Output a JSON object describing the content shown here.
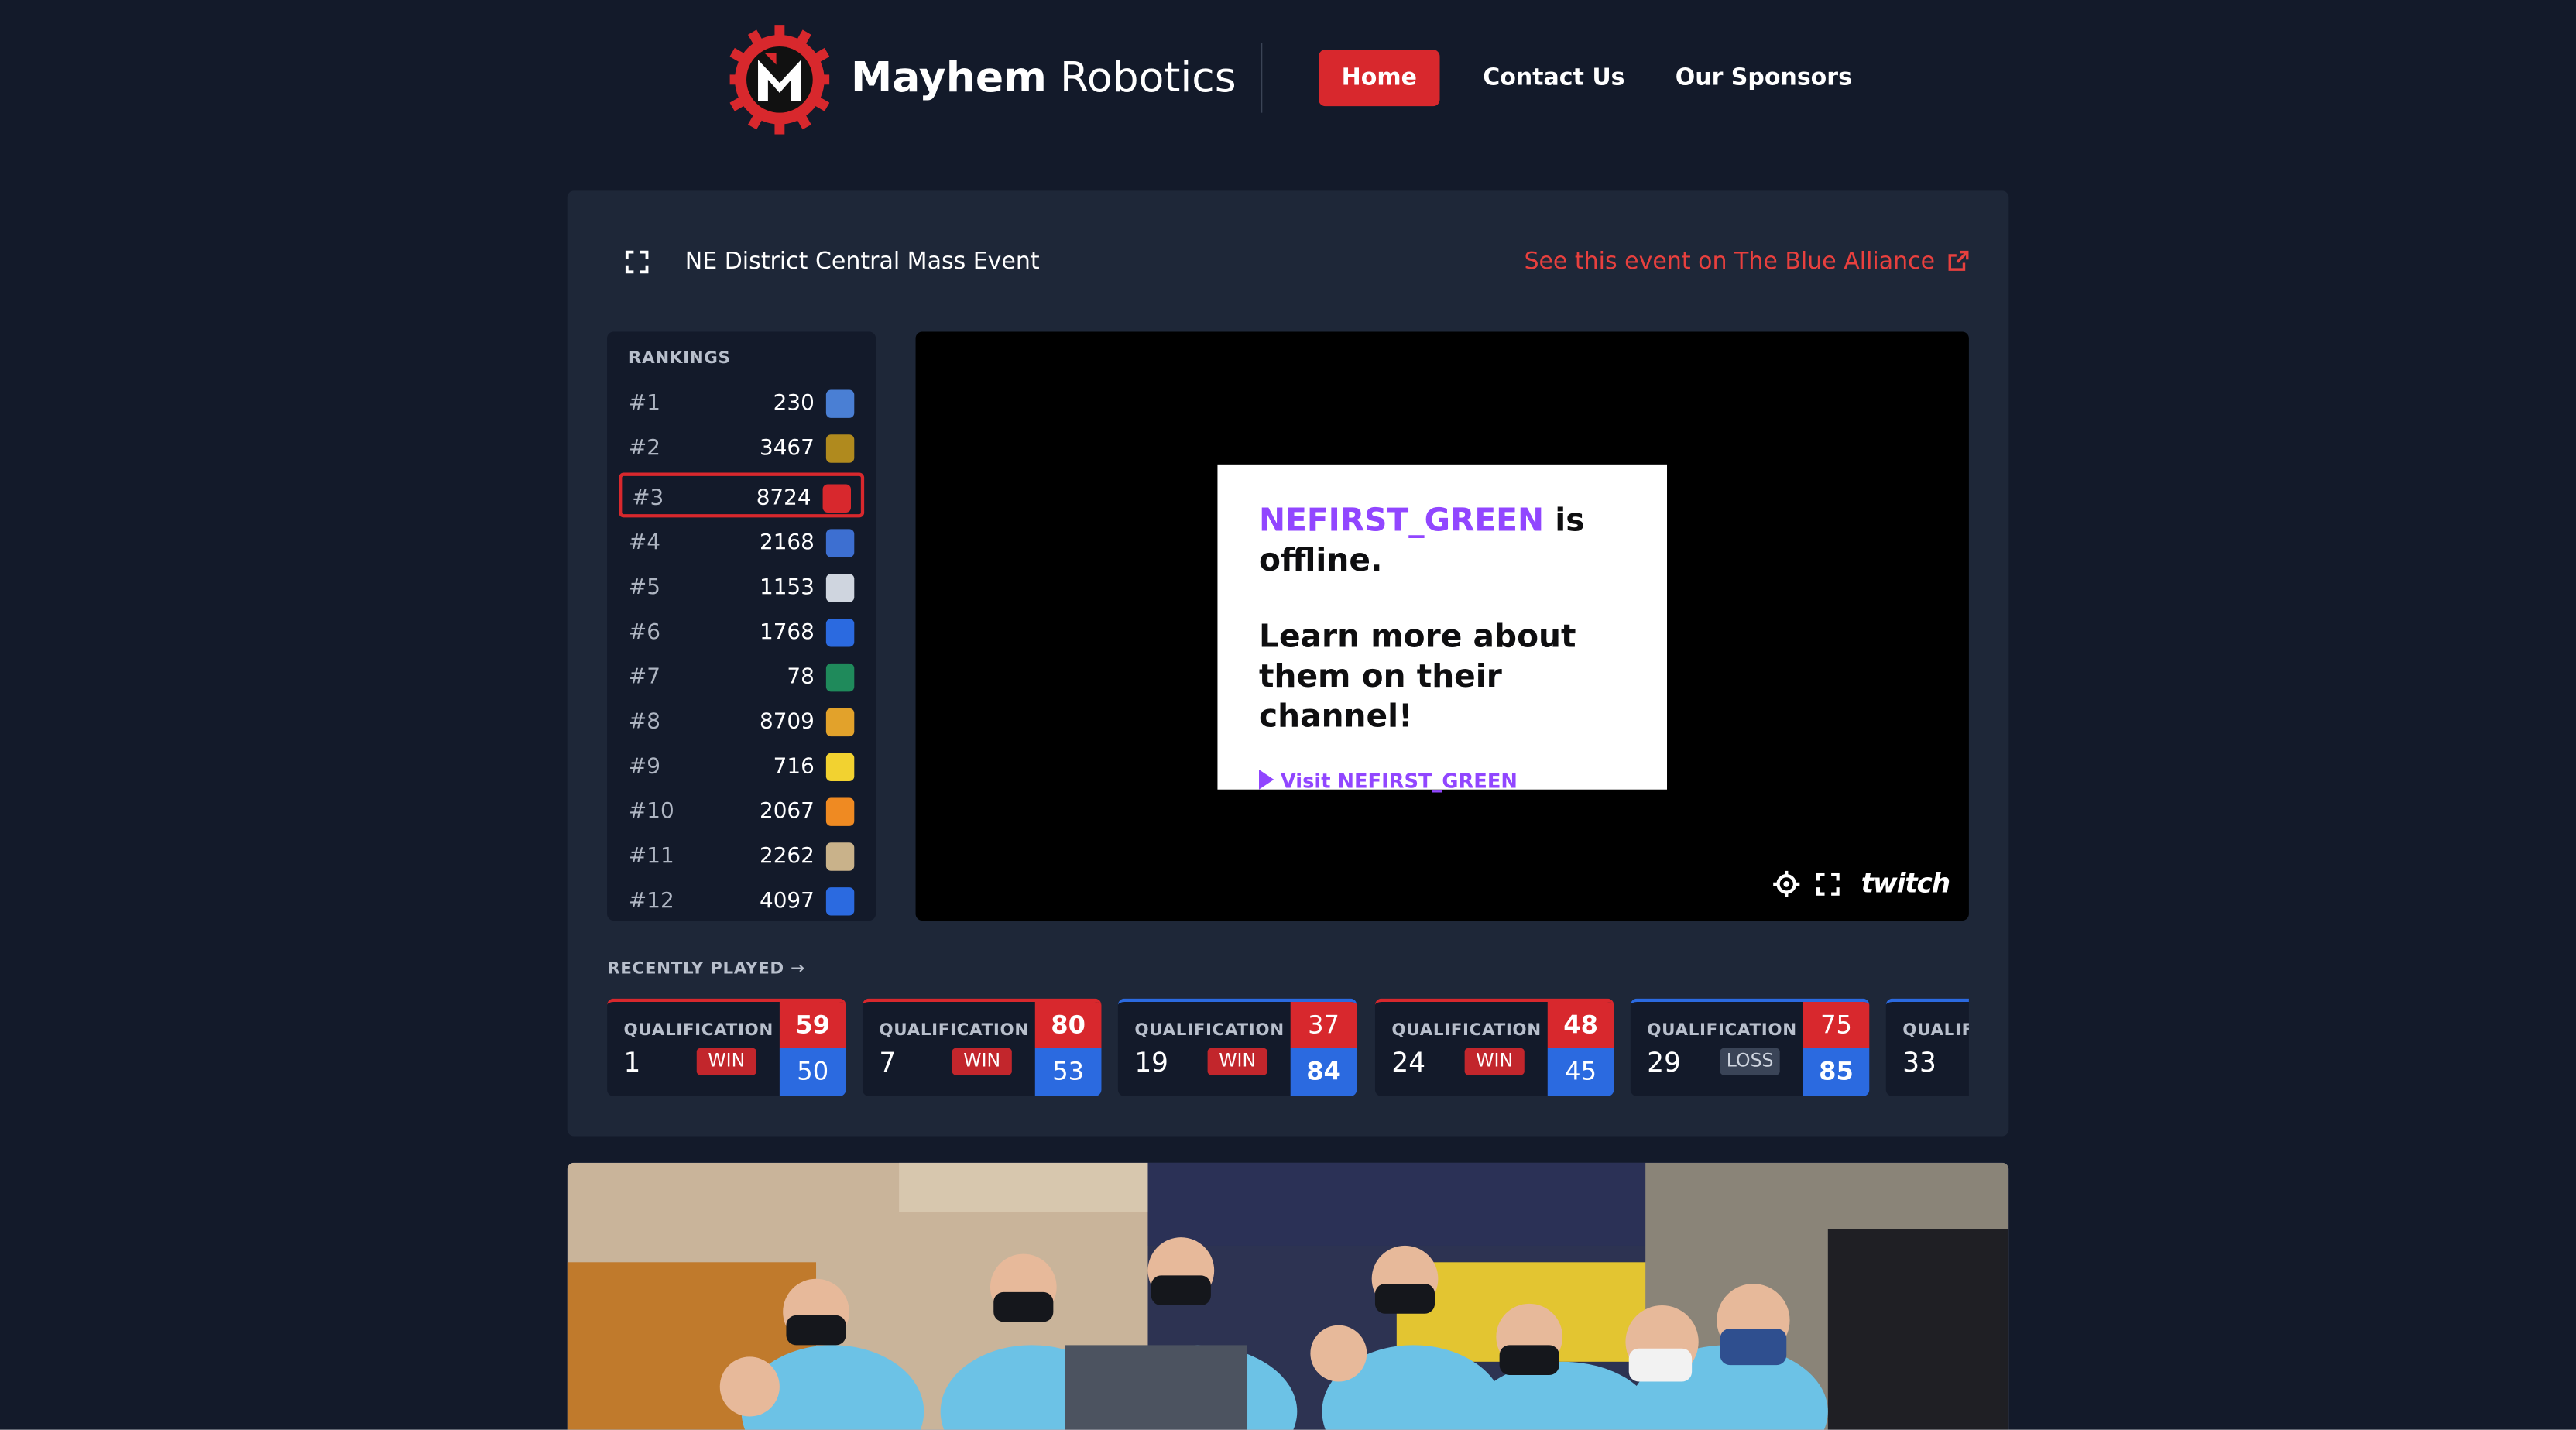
{
  "header": {
    "brand_bold": "Mayhem",
    "brand_light": "Robotics",
    "nav": {
      "home": "Home",
      "contact": "Contact Us",
      "sponsors": "Our Sponsors"
    }
  },
  "event": {
    "name": "NE District Central Mass Event",
    "tba_link": "See this event on The Blue Alliance"
  },
  "rankings": {
    "title": "RANKINGS",
    "rows": [
      {
        "rank": "#1",
        "team": "230",
        "avatar_color": "#4a7fd4"
      },
      {
        "rank": "#2",
        "team": "3467",
        "avatar_color": "#b08a1e"
      },
      {
        "rank": "#3",
        "team": "8724",
        "avatar_color": "#d8282d"
      },
      {
        "rank": "#4",
        "team": "2168",
        "avatar_color": "#3d6fd1"
      },
      {
        "rank": "#5",
        "team": "1153",
        "avatar_color": "#cfd5df"
      },
      {
        "rank": "#6",
        "team": "1768",
        "avatar_color": "#2b6ae0"
      },
      {
        "rank": "#7",
        "team": "78",
        "avatar_color": "#1f8a5b"
      },
      {
        "rank": "#8",
        "team": "8709",
        "avatar_color": "#e2a22b"
      },
      {
        "rank": "#9",
        "team": "716",
        "avatar_color": "#f2d230"
      },
      {
        "rank": "#10",
        "team": "2067",
        "avatar_color": "#ef8a22"
      },
      {
        "rank": "#11",
        "team": "2262",
        "avatar_color": "#c9b28a"
      },
      {
        "rank": "#12",
        "team": "4097",
        "avatar_color": "#2b6ae0"
      }
    ]
  },
  "stream": {
    "channel": "NEFIRST_GREEN",
    "offline_suffix": "is offline.",
    "learn_more": "Learn more about them on their channel!",
    "visit": "Visit NEFIRST_GREEN",
    "brand": "twitch"
  },
  "recent": {
    "title": "RECENTLY PLAYED",
    "matches": [
      {
        "type": "QUALIFICATION",
        "num": "1",
        "result": "WIN",
        "red": "59",
        "blue": "50",
        "winner": "red"
      },
      {
        "type": "QUALIFICATION",
        "num": "7",
        "result": "WIN",
        "red": "80",
        "blue": "53",
        "winner": "red"
      },
      {
        "type": "QUALIFICATION",
        "num": "19",
        "result": "WIN",
        "red": "37",
        "blue": "84",
        "winner": "blue"
      },
      {
        "type": "QUALIFICATION",
        "num": "24",
        "result": "WIN",
        "red": "48",
        "blue": "45",
        "winner": "red"
      },
      {
        "type": "QUALIFICATION",
        "num": "29",
        "result": "LOSS",
        "red": "75",
        "blue": "85",
        "winner": "blue"
      },
      {
        "type": "QUALIFICATION",
        "num": "33",
        "result": "",
        "red": "",
        "blue": "",
        "winner": "blue"
      }
    ]
  },
  "colors": {
    "background": "#131a2a",
    "card": "#1e2738",
    "accent_red": "#d8282d",
    "alliance_blue": "#2b6ae0",
    "twitch_purple": "#9146ff"
  }
}
